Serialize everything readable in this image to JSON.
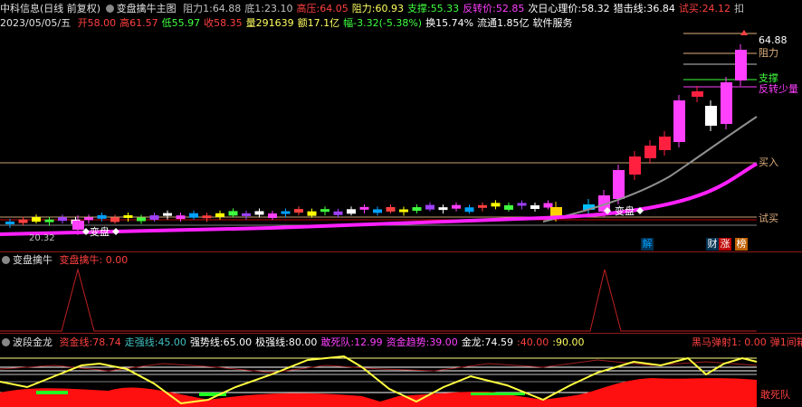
{
  "header": {
    "stock_name": "中科信息(日线 前复权)",
    "indicator_name": "变盘擒牛主图",
    "items": [
      {
        "label": "阻力1:",
        "value": "64.88",
        "color": "#c0c0c0"
      },
      {
        "label": "底1:",
        "value": "23.10",
        "color": "#c0c0c0"
      },
      {
        "label": "高压:",
        "value": "64.05",
        "color": "#ff4040"
      },
      {
        "label": "阻力:",
        "value": "60.93",
        "color": "#ffff60"
      },
      {
        "label": "支撑:",
        "value": "55.33",
        "color": "#40ff40"
      },
      {
        "label": "反转价:",
        "value": "52.85",
        "color": "#ff40ff"
      },
      {
        "label": "次日心理价:",
        "value": "58.32",
        "color": "#ffffff"
      },
      {
        "label": "猎击线:",
        "value": "36.84",
        "color": "#ffffff"
      },
      {
        "label": "试买:",
        "value": "24.12",
        "color": "#ff4040"
      },
      {
        "label": "扣",
        "value": "",
        "color": "#c0c0c0"
      }
    ],
    "date": "2023/05/05/五",
    "quote": [
      {
        "label": "开",
        "value": "58.00",
        "color": "#ff4040"
      },
      {
        "label": "高",
        "value": "61.57",
        "color": "#ff4040"
      },
      {
        "label": "低",
        "value": "55.97",
        "color": "#40ff40"
      },
      {
        "label": "收",
        "value": "58.35",
        "color": "#ff4040"
      },
      {
        "label": "量",
        "value": "291639",
        "color": "#ffff60"
      },
      {
        "label": "额",
        "value": "17.1亿",
        "color": "#ffff60"
      },
      {
        "label": "幅",
        "value": "-3.32(-5.38%)",
        "color": "#40ff40"
      },
      {
        "label": "换",
        "value": "15.74%",
        "color": "#ffffff"
      },
      {
        "label": "流通",
        "value": "1.85亿",
        "color": "#ffffff"
      },
      {
        "label": "",
        "value": "软件服务",
        "color": "#ffffff"
      }
    ]
  },
  "main_chart": {
    "price_tag_top": "64.88",
    "level_labels": {
      "resistance": "阻力",
      "support": "支撑",
      "reversal": "反转少量",
      "buy": "买入",
      "trial_buy": "试买"
    },
    "pivot_marker_left": "变盘",
    "pivot_marker_right": "变盘",
    "low_price_tag": "20.32",
    "badges": [
      {
        "text": "解",
        "color": "#00a0ff",
        "bg": "#003050"
      },
      {
        "text": "财",
        "color": "#ffffff",
        "bg": "#003050"
      },
      {
        "text": "涨",
        "color": "#ffffff",
        "bg": "#c00000"
      },
      {
        "text": "榜",
        "color": "#ffffff",
        "bg": "#c06000"
      }
    ]
  },
  "panel2": {
    "title": "变盘擒牛",
    "value_label": "变盘擒牛: 0.00"
  },
  "panel3": {
    "title": "波段金龙",
    "items": [
      {
        "label": "资金线:",
        "value": "78.74",
        "color": "#ff4040"
      },
      {
        "label": "走强线:",
        "value": "45.00",
        "color": "#40c0c0"
      },
      {
        "label": "强势线:",
        "value": "65.00",
        "color": "#ffffff"
      },
      {
        "label": "极强线:",
        "value": "80.00",
        "color": "#ffffff"
      },
      {
        "label": "敢死队:",
        "value": "12.99",
        "color": "#ff40ff"
      },
      {
        "label": "资金趋势:",
        "value": "39.00",
        "color": "#ff40ff"
      },
      {
        "label": "金龙:",
        "value": "74.59",
        "color": "#ffffff"
      },
      {
        "label": ":",
        "value": "40.00",
        "color": "#ff4040"
      },
      {
        "label": ":",
        "value": "90.00",
        "color": "#ffff60"
      }
    ],
    "right_items": [
      {
        "text": "黑马弹射1: 0.00",
        "color": "#ff4040"
      },
      {
        "text": "弹1间箱",
        "color": "#ff4040"
      }
    ],
    "legend_bottom": "敢死队"
  }
}
